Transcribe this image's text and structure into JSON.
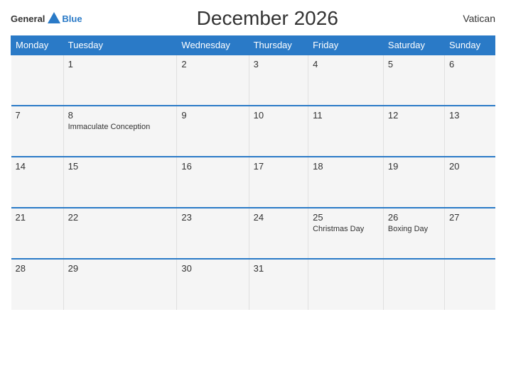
{
  "header": {
    "logo_general": "General",
    "logo_blue": "Blue",
    "title": "December 2026",
    "country": "Vatican"
  },
  "days_of_week": [
    "Monday",
    "Tuesday",
    "Wednesday",
    "Thursday",
    "Friday",
    "Saturday",
    "Sunday"
  ],
  "weeks": [
    {
      "cells": [
        {
          "day": "",
          "holiday": ""
        },
        {
          "day": "1",
          "holiday": ""
        },
        {
          "day": "2",
          "holiday": ""
        },
        {
          "day": "3",
          "holiday": ""
        },
        {
          "day": "4",
          "holiday": ""
        },
        {
          "day": "5",
          "holiday": ""
        },
        {
          "day": "6",
          "holiday": ""
        }
      ]
    },
    {
      "cells": [
        {
          "day": "7",
          "holiday": ""
        },
        {
          "day": "8",
          "holiday": "Immaculate Conception"
        },
        {
          "day": "9",
          "holiday": ""
        },
        {
          "day": "10",
          "holiday": ""
        },
        {
          "day": "11",
          "holiday": ""
        },
        {
          "day": "12",
          "holiday": ""
        },
        {
          "day": "13",
          "holiday": ""
        }
      ]
    },
    {
      "cells": [
        {
          "day": "14",
          "holiday": ""
        },
        {
          "day": "15",
          "holiday": ""
        },
        {
          "day": "16",
          "holiday": ""
        },
        {
          "day": "17",
          "holiday": ""
        },
        {
          "day": "18",
          "holiday": ""
        },
        {
          "day": "19",
          "holiday": ""
        },
        {
          "day": "20",
          "holiday": ""
        }
      ]
    },
    {
      "cells": [
        {
          "day": "21",
          "holiday": ""
        },
        {
          "day": "22",
          "holiday": ""
        },
        {
          "day": "23",
          "holiday": ""
        },
        {
          "day": "24",
          "holiday": ""
        },
        {
          "day": "25",
          "holiday": "Christmas Day"
        },
        {
          "day": "26",
          "holiday": "Boxing Day"
        },
        {
          "day": "27",
          "holiday": ""
        }
      ]
    },
    {
      "cells": [
        {
          "day": "28",
          "holiday": ""
        },
        {
          "day": "29",
          "holiday": ""
        },
        {
          "day": "30",
          "holiday": ""
        },
        {
          "day": "31",
          "holiday": ""
        },
        {
          "day": "",
          "holiday": ""
        },
        {
          "day": "",
          "holiday": ""
        },
        {
          "day": "",
          "holiday": ""
        }
      ]
    }
  ]
}
